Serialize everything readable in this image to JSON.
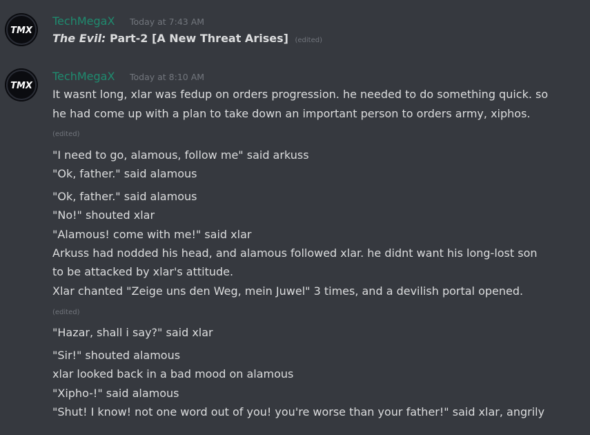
{
  "messages": [
    {
      "author": "TechMegaX",
      "avatar_text": "TMX",
      "timestamp": "Today at 7:43 AM",
      "title_italic": "The Evil:",
      "title_rest": "Part-2 [A New Threat Arises]",
      "edited": "(edited)"
    },
    {
      "author": "TechMegaX",
      "avatar_text": "TMX",
      "timestamp": "Today at 8:10 AM",
      "lines": [
        "It wasnt long, xlar was fedup on orders progression. he needed to do something quick. so",
        "he had come up with a plan to take down an important person to orders army, xiphos.",
        "\"I need to go, alamous, follow me\" said arkuss",
        "\"Ok, father.\" said alamous",
        "\"Ok, father.\" said alamous",
        "\"No!\" shouted xlar",
        "\"Alamous! come with me!\" said xlar",
        "Arkuss had nodded his head, and alamous followed xlar. he didnt want his long-lost son",
        "to be attacked by xlar's attitude.",
        "Xlar chanted \"Zeige uns den Weg, mein Juwel\" 3 times, and a devilish portal opened.",
        "\"Hazar, shall i say?\" said xlar",
        "\"Sir!\" shouted alamous",
        "xlar looked back in a bad mood on alamous",
        "\"Xipho-!\" said alamous",
        "\"Shut! I know! not one word out of you! you're worse than your father!\" said xlar, angrily"
      ],
      "edited_1": "(edited)",
      "edited_2": "(edited)"
    }
  ],
  "colors": {
    "background": "#36393f",
    "username": "#1f8b6f",
    "text": "#dcddde",
    "muted": "#72767d"
  }
}
